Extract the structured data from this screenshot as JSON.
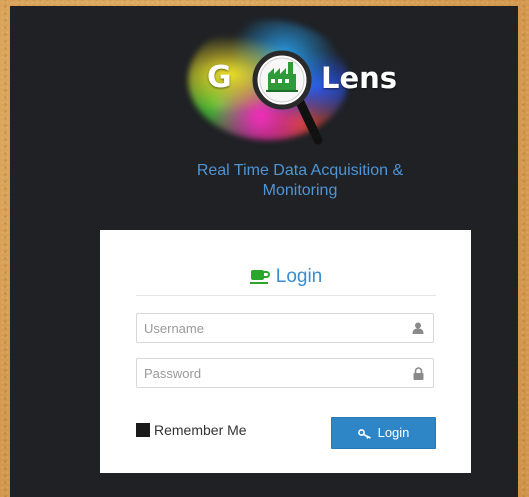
{
  "brand": {
    "logo_letter": "G",
    "logo_word": "Lens",
    "tagline_line1": "Real Time Data Acquisition &",
    "tagline_line2": "Monitoring"
  },
  "login_form": {
    "title": "Login",
    "title_icon": "coffee-cup-icon",
    "username": {
      "placeholder": "Username",
      "value": "",
      "icon": "user-icon"
    },
    "password": {
      "placeholder": "Password",
      "value": "",
      "icon": "lock-icon"
    },
    "remember_label": "Remember Me",
    "remember_checked": true,
    "submit_label": "Login",
    "submit_icon": "key-icon"
  },
  "colors": {
    "panel_bg": "#1f2125",
    "accent_blue": "#2f86c7",
    "title_blue": "#3a8bcf",
    "title_icon_green": "#2aa62a",
    "page_bg": "#d9a257"
  }
}
